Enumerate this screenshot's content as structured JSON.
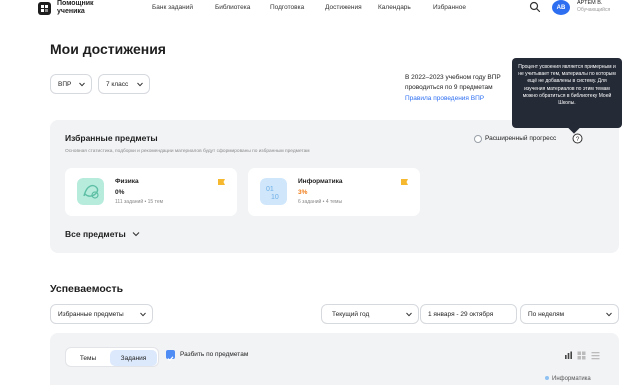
{
  "header": {
    "logo_line1": "Помощник",
    "logo_line2": "ученика",
    "nav": [
      {
        "label": "Банк заданий"
      },
      {
        "label": "Библиотека"
      },
      {
        "label": "Подготовка"
      },
      {
        "label": "Достижения"
      },
      {
        "label": "Календарь"
      },
      {
        "label": "Избранное"
      }
    ],
    "user": {
      "initials": "АВ",
      "name": "АРТЕМ В.",
      "role": "Обучающийся"
    }
  },
  "page_title": "Мои достижения",
  "filters": {
    "exam": "ВПР",
    "grade": "7 класс"
  },
  "info": {
    "text": "В 2022–2023 учебном году ВПР проводиться по 9 предметам",
    "link": "Правила проведения ВПР"
  },
  "tooltip": {
    "text": "Процент усвоения является примерным и не учитывает тем, материалы по которым ещё не добавлены в систему. Для изучения материалов по этим темам можно обратиться в библиотеку Моей Школы."
  },
  "favorites": {
    "title": "Избранные предметы",
    "description": "Основная статистика, подборки и рекомендации материалов будут сформированы по избранным предметам",
    "toggle_label": "Расширенный прогресс",
    "subjects": [
      {
        "name": "Физика",
        "percent": "0%",
        "meta": "111 заданий • 15 тем",
        "percent_color": "#1e1e1e"
      },
      {
        "name": "Информатика",
        "percent": "3%",
        "meta": "6 заданий • 4 темы",
        "percent_color": "#f07d1a"
      }
    ],
    "all_subjects": "Все предметы"
  },
  "performance": {
    "title": "Успеваемость",
    "filter_subjects": "Избранные предметы",
    "period": "Текущий год",
    "date_range": "1 января - 29 октября",
    "grouping": "По неделям",
    "tabs": [
      {
        "label": "Темы"
      },
      {
        "label": "Задания"
      }
    ],
    "split_label": "Разбить по предметам",
    "legend": "Информатика"
  },
  "colors": {
    "accent": "#2e6ff2",
    "panel": "#f2f3f5",
    "tooltip_bg": "#242a36",
    "flag": "#f5b82e"
  }
}
